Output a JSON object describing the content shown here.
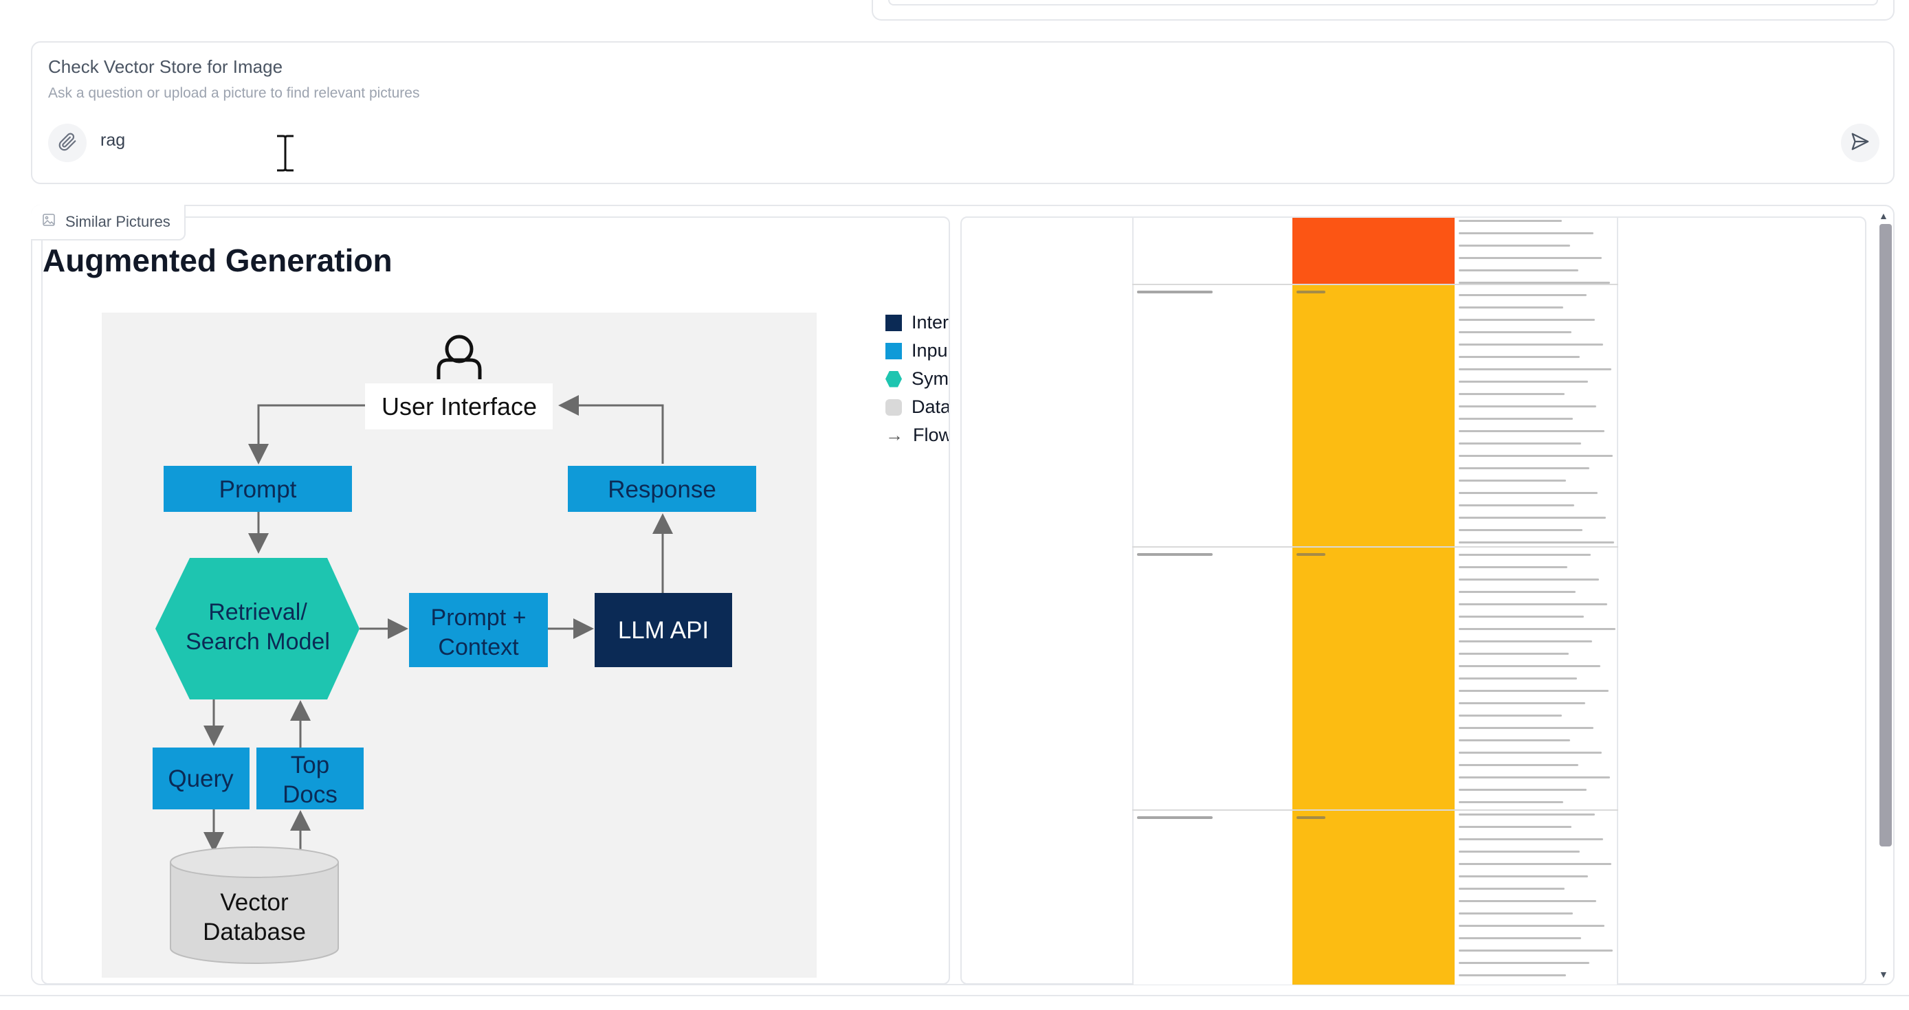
{
  "chat": {
    "title": "Check Vector Store for Image",
    "subtitle": "Ask a question or upload a picture to find relevant pictures",
    "input_value": "rag",
    "attach_icon": "paperclip-icon",
    "send_icon": "send-icon"
  },
  "gallery": {
    "label": "Similar Pictures",
    "label_icon": "image-icon"
  },
  "diagram": {
    "title": "Augmented Generation",
    "nodes": {
      "user_interface": "User Interface",
      "prompt": "Prompt",
      "response": "Response",
      "retrieval_line1": "Retrieval/",
      "retrieval_line2": "Search Model",
      "prompt_context_line1": "Prompt +",
      "prompt_context_line2": "Context",
      "llm_api": "LLM API",
      "query": "Query",
      "top_docs_line1": "Top",
      "top_docs_line2": "Docs",
      "vector_db_line1": "Vector",
      "vector_db_line2": "Database"
    },
    "legend": [
      "Inter",
      "Inpu",
      "Sym",
      "Data",
      "Flow"
    ],
    "colors": {
      "dark_navy": "#0b2a55",
      "blue": "#0f9ad8",
      "teal": "#1ec5b0",
      "gray": "#d9d9d9"
    }
  },
  "table_image": {
    "colors": {
      "orange": "#fc5514",
      "amber": "#fcbc12"
    }
  }
}
